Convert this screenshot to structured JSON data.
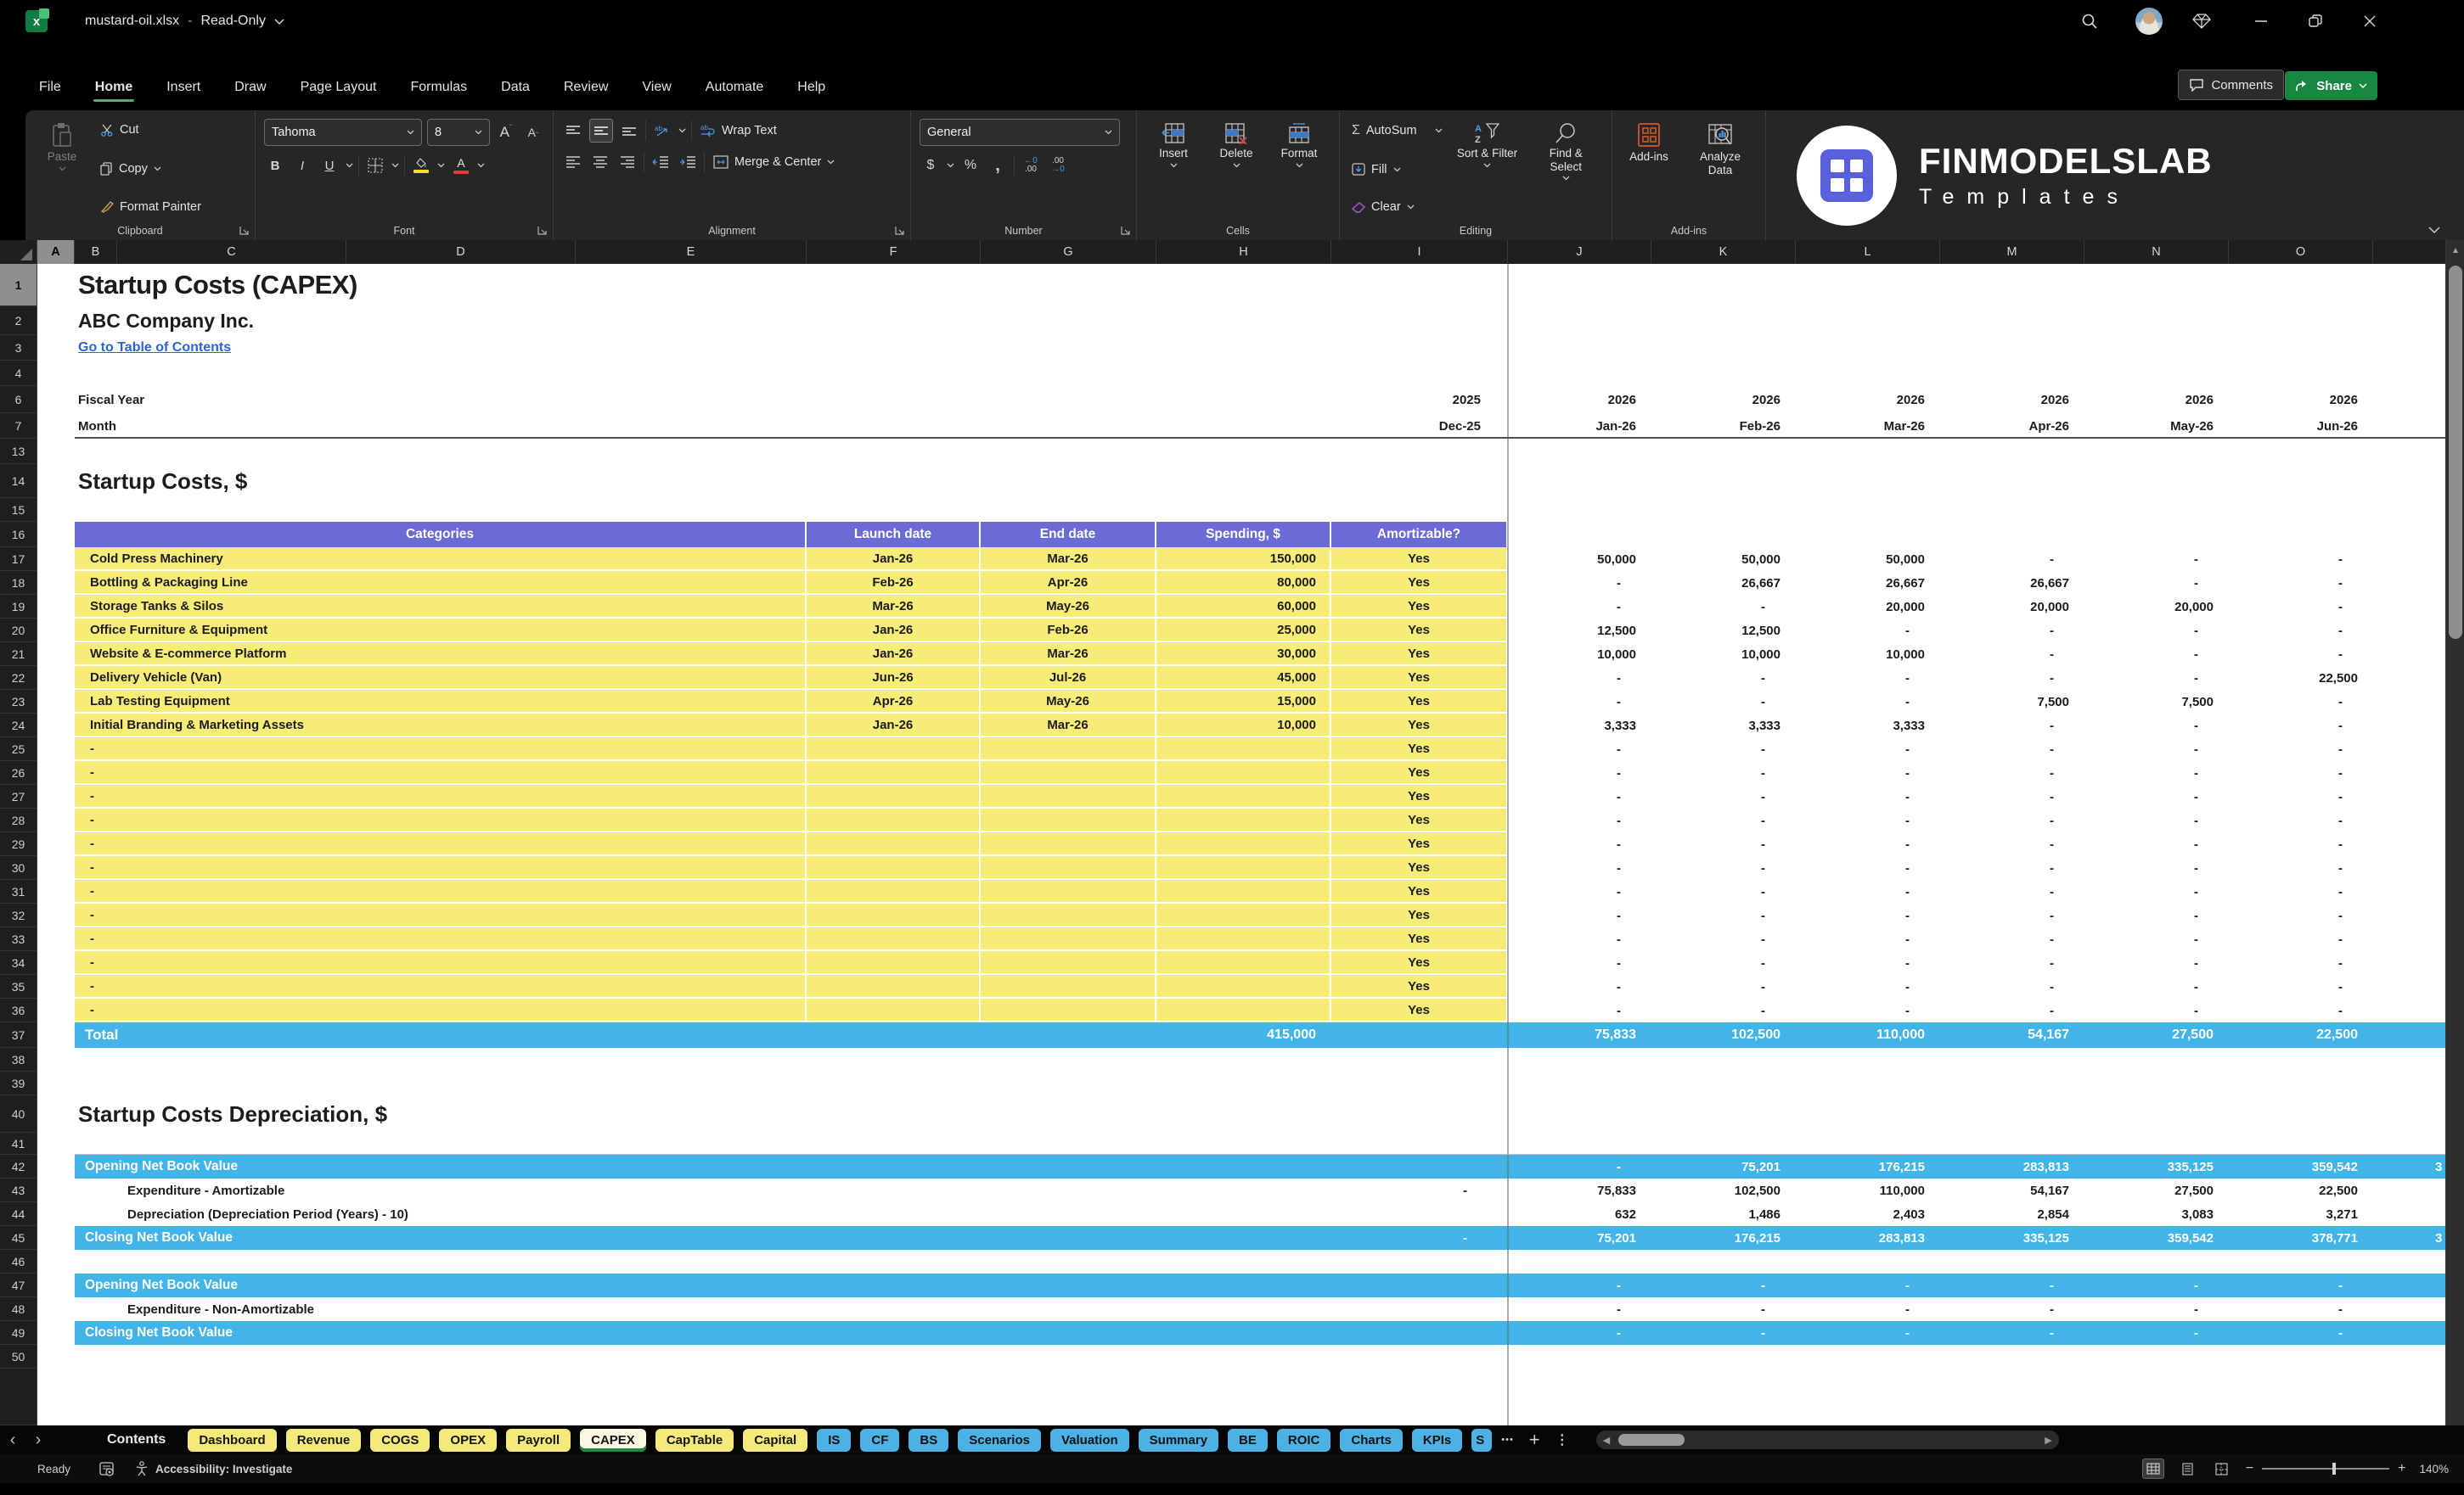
{
  "window": {
    "filename": "mustard-oil.xlsx",
    "separator": "-",
    "mode": "Read-Only"
  },
  "menu": {
    "tabs": [
      "File",
      "Home",
      "Insert",
      "Draw",
      "Page Layout",
      "Formulas",
      "Data",
      "Review",
      "View",
      "Automate",
      "Help"
    ],
    "active_tab": "Home",
    "comments": "Comments",
    "share": "Share"
  },
  "ribbon": {
    "clipboard": {
      "paste": "Paste",
      "cut": "Cut",
      "copy": "Copy",
      "format_painter": "Format Painter",
      "group_label": "Clipboard"
    },
    "font": {
      "font_name": "Tahoma",
      "font_size": "8",
      "group_label": "Font"
    },
    "alignment": {
      "wrap_text": "Wrap Text",
      "merge_center": "Merge & Center",
      "group_label": "Alignment"
    },
    "number": {
      "format": "General",
      "group_label": "Number"
    },
    "cells": {
      "insert": "Insert",
      "delete": "Delete",
      "format": "Format",
      "group_label": "Cells"
    },
    "editing": {
      "autosum": "AutoSum",
      "fill": "Fill",
      "clear": "Clear",
      "sort_filter": "Sort & Filter",
      "find_select": "Find & Select",
      "group_label": "Editing"
    },
    "addins": {
      "addins": "Add-ins",
      "analyze_data": "Analyze Data",
      "group_label": "Add-ins"
    },
    "brand": {
      "line1": "FINMODELSLAB",
      "line2": "Templates"
    }
  },
  "sheet": {
    "columns": [
      "A",
      "B",
      "C",
      "D",
      "E",
      "F",
      "G",
      "H",
      "I",
      "J",
      "K",
      "L",
      "M",
      "N",
      "O"
    ],
    "selected_column": "A",
    "selected_row": 1,
    "title": "Startup Costs (CAPEX)",
    "company": "ABC Company Inc.",
    "toc_link": "Go to Table of Contents",
    "fiscal_year_label": "Fiscal Year",
    "month_label": "Month",
    "dec_year": "2025",
    "dec_month": "Dec-25",
    "year_cols": [
      "2026",
      "2026",
      "2026",
      "2026",
      "2026",
      "2026"
    ],
    "month_cols": [
      "Jan-26",
      "Feb-26",
      "Mar-26",
      "Apr-26",
      "May-26",
      "Jun-26"
    ],
    "section1": {
      "heading": "Startup Costs, $",
      "headers": [
        "Categories",
        "Launch date",
        "End date",
        "Spending, $",
        "Amortizable?"
      ],
      "items": [
        {
          "row": 17,
          "category": "Cold Press Machinery",
          "launch": "Jan-26",
          "end": "Mar-26",
          "spending": "150,000",
          "amortizable": "Yes",
          "monthly": [
            "50,000",
            "50,000",
            "50,000",
            "-",
            "-",
            "-"
          ]
        },
        {
          "row": 18,
          "category": "Bottling & Packaging Line",
          "launch": "Feb-26",
          "end": "Apr-26",
          "spending": "80,000",
          "amortizable": "Yes",
          "monthly": [
            "-",
            "26,667",
            "26,667",
            "26,667",
            "-",
            "-"
          ]
        },
        {
          "row": 19,
          "category": "Storage Tanks & Silos",
          "launch": "Mar-26",
          "end": "May-26",
          "spending": "60,000",
          "amortizable": "Yes",
          "monthly": [
            "-",
            "-",
            "20,000",
            "20,000",
            "20,000",
            "-"
          ]
        },
        {
          "row": 20,
          "category": "Office Furniture & Equipment",
          "launch": "Jan-26",
          "end": "Feb-26",
          "spending": "25,000",
          "amortizable": "Yes",
          "monthly": [
            "12,500",
            "12,500",
            "-",
            "-",
            "-",
            "-"
          ]
        },
        {
          "row": 21,
          "category": "Website & E-commerce Platform",
          "launch": "Jan-26",
          "end": "Mar-26",
          "spending": "30,000",
          "amortizable": "Yes",
          "monthly": [
            "10,000",
            "10,000",
            "10,000",
            "-",
            "-",
            "-"
          ]
        },
        {
          "row": 22,
          "category": "Delivery Vehicle (Van)",
          "launch": "Jun-26",
          "end": "Jul-26",
          "spending": "45,000",
          "amortizable": "Yes",
          "monthly": [
            "-",
            "-",
            "-",
            "-",
            "-",
            "22,500"
          ]
        },
        {
          "row": 23,
          "category": "Lab Testing Equipment",
          "launch": "Apr-26",
          "end": "May-26",
          "spending": "15,000",
          "amortizable": "Yes",
          "monthly": [
            "-",
            "-",
            "-",
            "7,500",
            "7,500",
            "-"
          ]
        },
        {
          "row": 24,
          "category": "Initial Branding & Marketing Assets",
          "launch": "Jan-26",
          "end": "Mar-26",
          "spending": "10,000",
          "amortizable": "Yes",
          "monthly": [
            "3,333",
            "3,333",
            "3,333",
            "-",
            "-",
            "-"
          ]
        }
      ],
      "empty_rows": [
        25,
        26,
        27,
        28,
        29,
        30,
        31,
        32,
        33,
        34,
        35,
        36
      ],
      "empty_category": "-",
      "empty_amortizable": "Yes",
      "total": {
        "label": "Total",
        "spending": "415,000",
        "monthly": [
          "75,833",
          "102,500",
          "110,000",
          "54,167",
          "27,500",
          "22,500"
        ]
      }
    },
    "section2": {
      "heading": "Startup Costs Depreciation, $",
      "amortizable_block": {
        "opening": {
          "row": 42,
          "label": "Opening Net Book Value",
          "dec": "",
          "monthly": [
            "-",
            "75,201",
            "176,215",
            "283,813",
            "335,125",
            "359,542"
          ],
          "overflow": "3"
        },
        "expenditure": {
          "row": 43,
          "label": "Expenditure - Amortizable",
          "dec": "-",
          "monthly": [
            "75,833",
            "102,500",
            "110,000",
            "54,167",
            "27,500",
            "22,500"
          ],
          "overflow": ""
        },
        "depreciation": {
          "row": 44,
          "label": "Depreciation (Depreciation Period (Years) - 10)",
          "dec": "",
          "monthly": [
            "632",
            "1,486",
            "2,403",
            "2,854",
            "3,083",
            "3,271"
          ],
          "overflow": ""
        },
        "closing": {
          "row": 45,
          "label": "Closing Net Book Value",
          "dec": "-",
          "monthly": [
            "75,201",
            "176,215",
            "283,813",
            "335,125",
            "359,542",
            "378,771"
          ],
          "overflow": "3"
        }
      },
      "non_amortizable_block": {
        "opening": {
          "row": 47,
          "label": "Opening Net Book Value",
          "dec": "",
          "monthly": [
            "-",
            "-",
            "-",
            "-",
            "-",
            "-"
          ],
          "overflow": ""
        },
        "expenditure": {
          "row": 48,
          "label": "Expenditure - Non-Amortizable",
          "dec": "",
          "monthly": [
            "-",
            "-",
            "-",
            "-",
            "-",
            "-"
          ],
          "overflow": ""
        },
        "closing": {
          "row": 49,
          "label": "Closing Net Book Value",
          "dec": "",
          "monthly": [
            "-",
            "-",
            "-",
            "-",
            "-",
            "-"
          ],
          "overflow": ""
        }
      }
    }
  },
  "sheet_tabs": {
    "contents_label": "Contents",
    "tabs": [
      {
        "label": "Dashboard",
        "color": "yellow"
      },
      {
        "label": "Revenue",
        "color": "yellow"
      },
      {
        "label": "COGS",
        "color": "yellow"
      },
      {
        "label": "OPEX",
        "color": "yellow"
      },
      {
        "label": "Payroll",
        "color": "yellow"
      },
      {
        "label": "CAPEX",
        "color": "active"
      },
      {
        "label": "CapTable",
        "color": "yellow"
      },
      {
        "label": "Capital",
        "color": "yellow"
      },
      {
        "label": "IS",
        "color": "blue"
      },
      {
        "label": "CF",
        "color": "blue"
      },
      {
        "label": "BS",
        "color": "blue"
      },
      {
        "label": "Scenarios",
        "color": "blue"
      },
      {
        "label": "Valuation",
        "color": "blue"
      },
      {
        "label": "Summary",
        "color": "blue"
      },
      {
        "label": "BE",
        "color": "blue"
      },
      {
        "label": "ROIC",
        "color": "blue"
      },
      {
        "label": "Charts",
        "color": "blue"
      },
      {
        "label": "KPIs",
        "color": "blue"
      },
      {
        "label": "S",
        "color": "blue",
        "partial": true
      }
    ],
    "overflow_dots": "•••"
  },
  "status": {
    "ready": "Ready",
    "accessibility": "Accessibility: Investigate",
    "zoom_level": "140%"
  }
}
